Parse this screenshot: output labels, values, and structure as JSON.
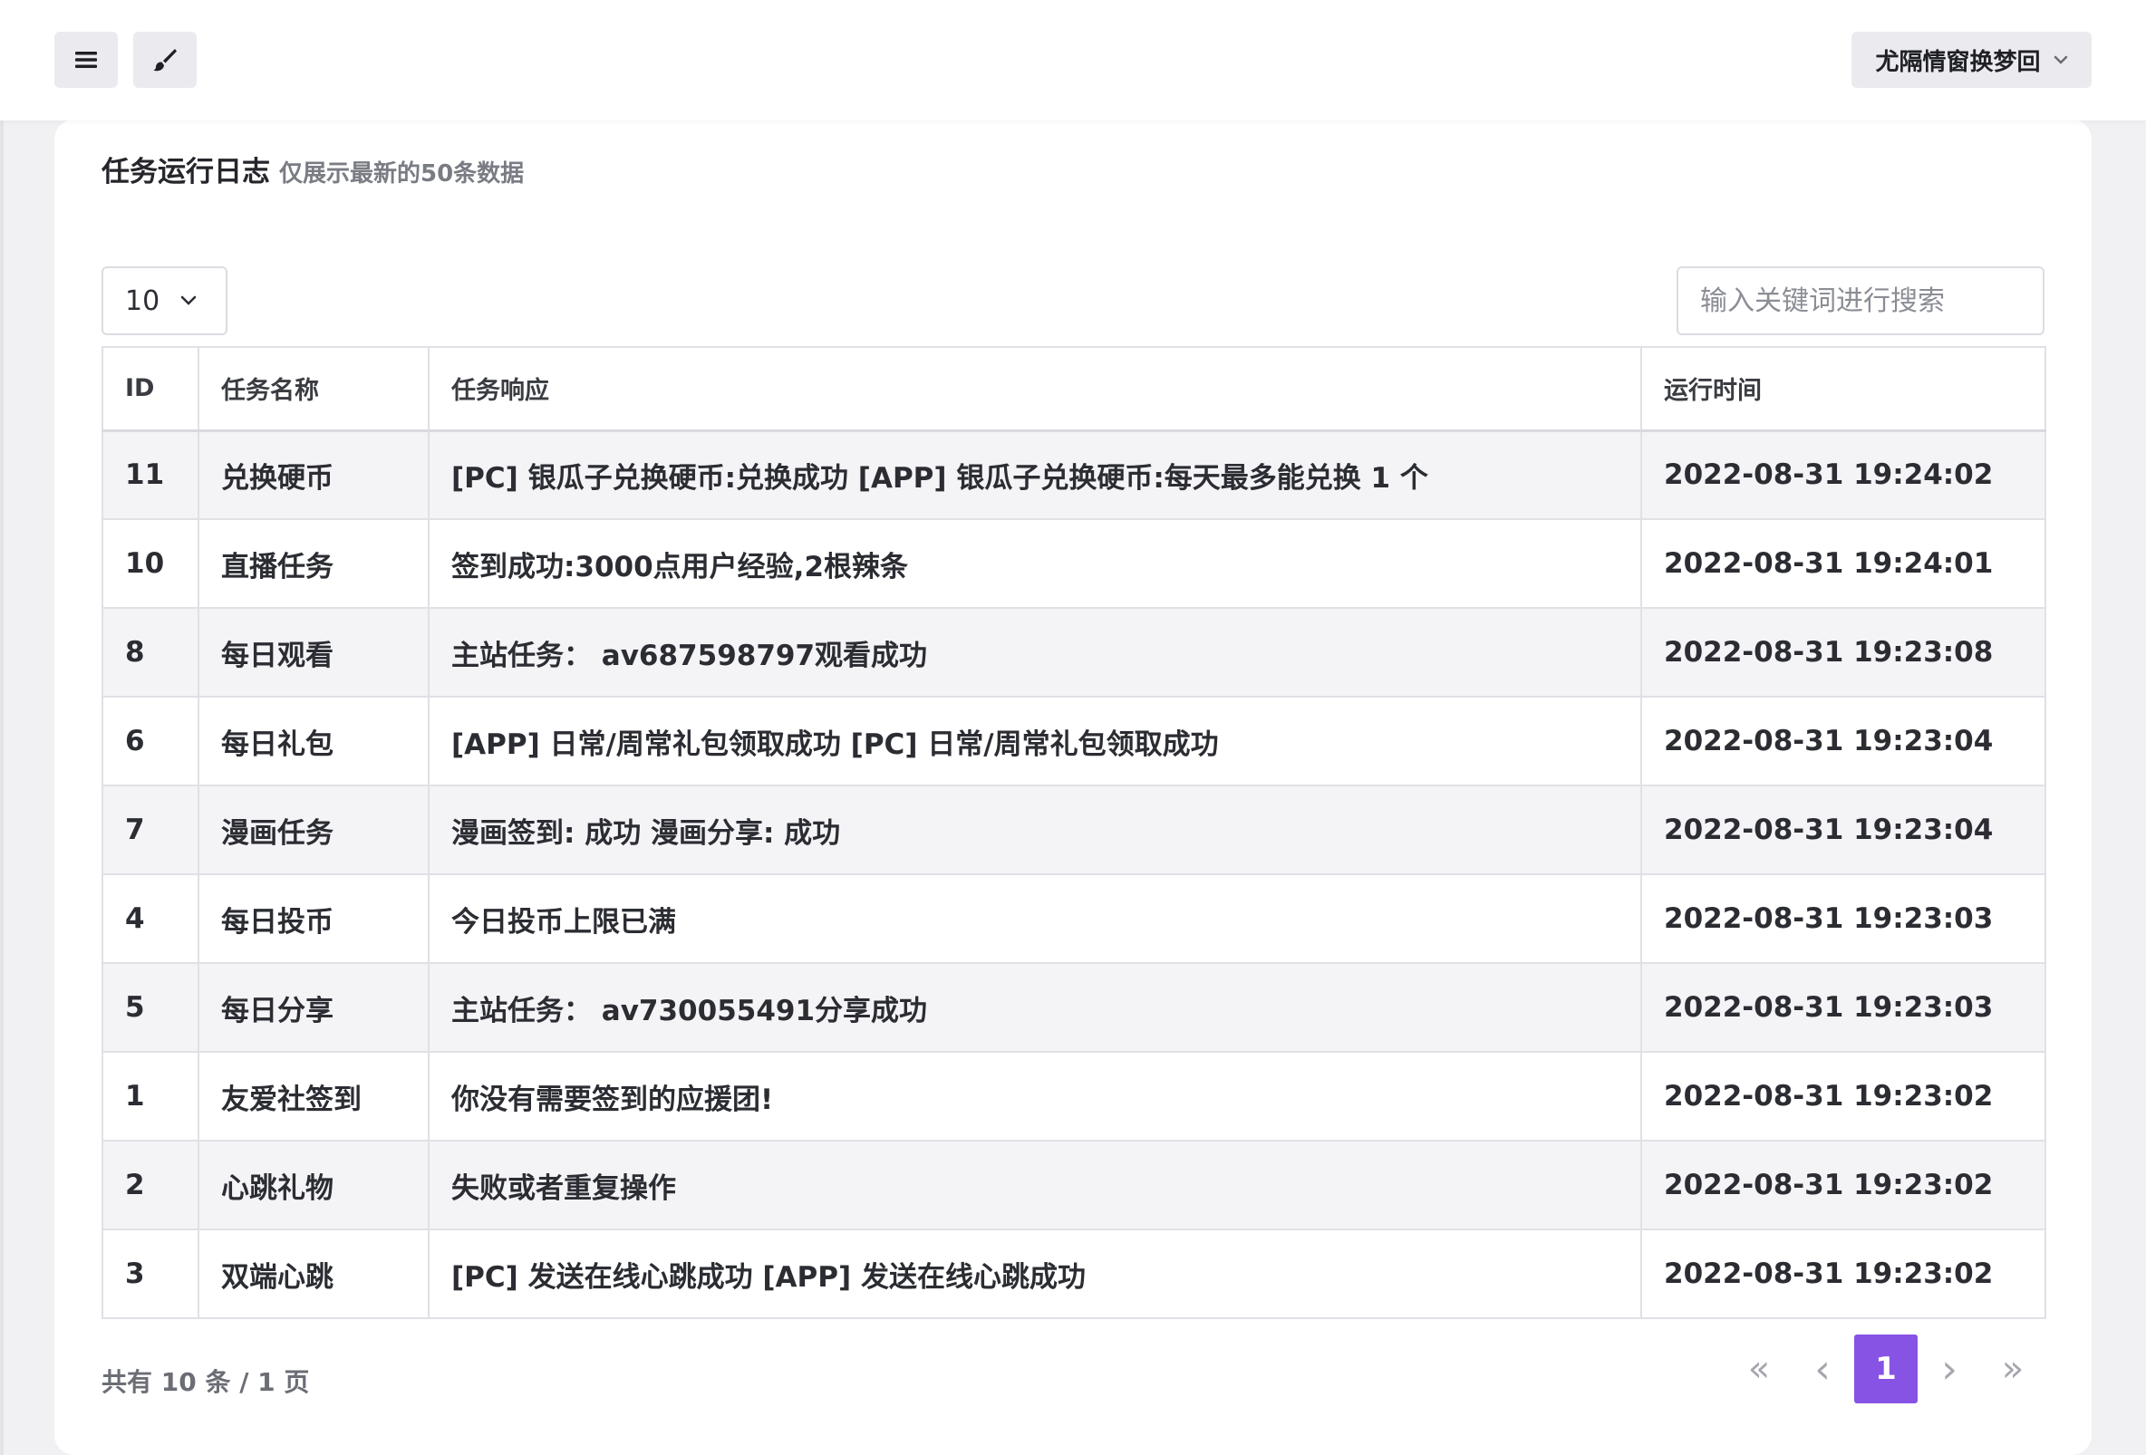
{
  "user": {
    "name": "尤隔情窗换梦回"
  },
  "card": {
    "title": "任务运行日志",
    "subtitle": "仅展示最新的50条数据"
  },
  "controls": {
    "page_size": "10",
    "search_placeholder": "输入关键词进行搜索"
  },
  "table": {
    "headers": {
      "id": "ID",
      "name": "任务名称",
      "response": "任务响应",
      "time": "运行时间"
    },
    "rows": [
      {
        "id": "11",
        "name": "兑换硬币",
        "response": "[PC] 银瓜子兑换硬币:兑换成功 [APP] 银瓜子兑换硬币:每天最多能兑换 1 个",
        "time": "2022-08-31 19:24:02"
      },
      {
        "id": "10",
        "name": "直播任务",
        "response": "签到成功:3000点用户经验,2根辣条",
        "time": "2022-08-31 19:24:01"
      },
      {
        "id": "8",
        "name": "每日观看",
        "response": "主站任务：  av687598797观看成功",
        "time": "2022-08-31 19:23:08"
      },
      {
        "id": "6",
        "name": "每日礼包",
        "response": "[APP] 日常/周常礼包领取成功 [PC] 日常/周常礼包领取成功",
        "time": "2022-08-31 19:23:04"
      },
      {
        "id": "7",
        "name": "漫画任务",
        "response": "漫画签到: 成功 漫画分享: 成功",
        "time": "2022-08-31 19:23:04"
      },
      {
        "id": "4",
        "name": "每日投币",
        "response": "今日投币上限已满",
        "time": "2022-08-31 19:23:03"
      },
      {
        "id": "5",
        "name": "每日分享",
        "response": "主站任务：  av730055491分享成功",
        "time": "2022-08-31 19:23:03"
      },
      {
        "id": "1",
        "name": "友爱社签到",
        "response": "你没有需要签到的应援团!",
        "time": "2022-08-31 19:23:02"
      },
      {
        "id": "2",
        "name": "心跳礼物",
        "response": "失败或者重复操作",
        "time": "2022-08-31 19:23:02"
      },
      {
        "id": "3",
        "name": "双端心跳",
        "response": "[PC] 发送在线心跳成功 [APP] 发送在线心跳成功",
        "time": "2022-08-31 19:23:02"
      }
    ]
  },
  "footer": {
    "summary": "共有 10 条 / 1 页",
    "current_page": "1",
    "icons": {
      "first": "«",
      "prev": "‹",
      "next": "›",
      "last": "»"
    }
  },
  "colors": {
    "accent": "#8753e4",
    "background": "#f1f1f4"
  }
}
